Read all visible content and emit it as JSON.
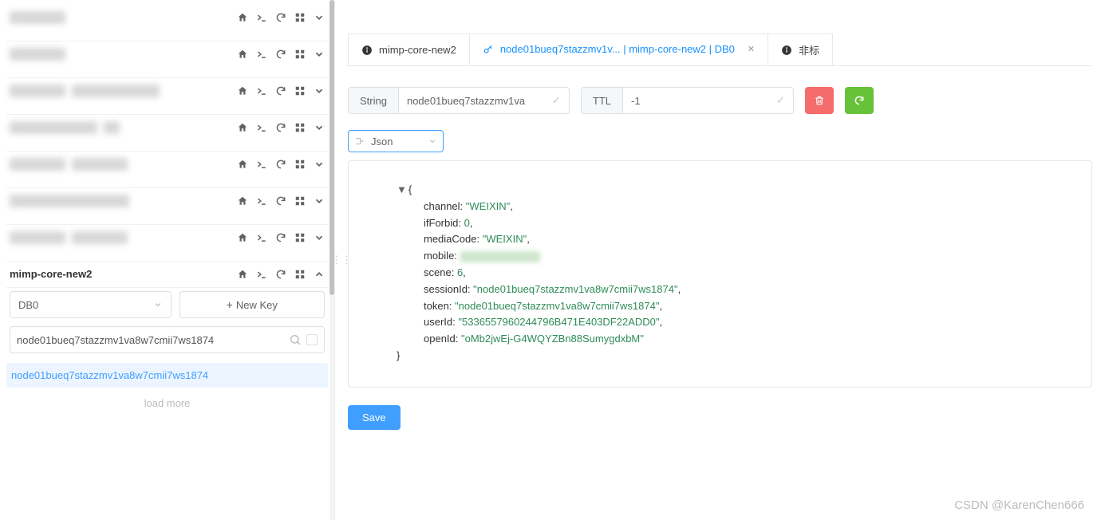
{
  "sidebar": {
    "active_conn": "mimp-core-new2",
    "db_selector": "DB0",
    "new_key_label": "New Key",
    "search_value": "node01bueq7stazzmv1va8w7cmii7ws1874",
    "keys": [
      "node01bueq7stazzmv1va8w7cmii7ws1874"
    ],
    "load_more": "load more"
  },
  "tabs": [
    {
      "label": "mimp-core-new2",
      "icon": "info"
    },
    {
      "label": "node01bueq7stazzmv1v... | mimp-core-new2 | DB0",
      "icon": "key",
      "active": true,
      "closable": true
    },
    {
      "label": "非标",
      "icon": "info"
    }
  ],
  "details": {
    "type_label": "String",
    "key_value": "node01bueq7stazzmv1va",
    "ttl_label": "TTL",
    "ttl_value": "-1",
    "format": "Json",
    "save_label": "Save"
  },
  "json_preview": {
    "channel": "WEIXIN",
    "ifForbid": 0,
    "mediaCode": "WEIXIN",
    "mobile": "[redacted]",
    "scene": 6,
    "sessionId": "node01bueq7stazzmv1va8w7cmii7ws1874",
    "token": "node01bueq7stazzmv1va8w7cmii7ws1874",
    "userId": "5336557960244796B471E403DF22ADD0",
    "openId": "oMb2jwEj-G4WQYZBn88SumygdxbM"
  },
  "watermark": "CSDN @KarenChen666"
}
